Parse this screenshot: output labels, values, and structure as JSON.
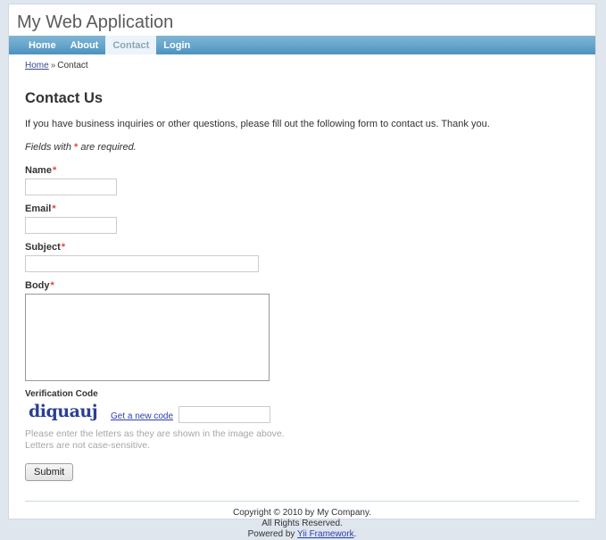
{
  "site": {
    "title": "My Web Application"
  },
  "nav": {
    "items": [
      {
        "label": "Home",
        "active": false
      },
      {
        "label": "About",
        "active": false
      },
      {
        "label": "Contact",
        "active": true
      },
      {
        "label": "Login",
        "active": false
      }
    ]
  },
  "breadcrumb": {
    "home_label": "Home",
    "separator": "»",
    "current": "Contact"
  },
  "main": {
    "heading": "Contact Us",
    "intro": "If you have business inquiries or other questions, please fill out the following form to contact us. Thank you.",
    "required_note_before": "Fields with",
    "required_note_star": "*",
    "required_note_after": "are required."
  },
  "form": {
    "fields": {
      "name": {
        "label": "Name",
        "required_star": "*",
        "value": "",
        "placeholder": ""
      },
      "email": {
        "label": "Email",
        "required_star": "*",
        "value": "",
        "placeholder": ""
      },
      "subject": {
        "label": "Subject",
        "required_star": "*",
        "value": "",
        "placeholder": ""
      },
      "body": {
        "label": "Body",
        "required_star": "*",
        "value": "",
        "placeholder": ""
      },
      "verification": {
        "label": "Verification Code",
        "captcha_text": "diquauj",
        "refresh_link": "Get a new code",
        "value": "",
        "placeholder": "",
        "hint_line1": "Please enter the letters as they are shown in the image above.",
        "hint_line2": "Letters are not case-sensitive."
      }
    },
    "submit_label": "Submit"
  },
  "footer": {
    "line1": "Copyright © 2010 by My Company.",
    "line2": "All Rights Reserved.",
    "powered_prefix": "Powered by",
    "powered_link": "Yii Framework",
    "powered_suffix": "."
  },
  "colors": {
    "nav_top": "#7fb4d4",
    "nav_bottom": "#4c92bd",
    "nav_active_bg": "#eaf4fa",
    "required_star": "#e8413a",
    "link": "#2a3fb0",
    "captcha": "#2b3f93",
    "page_bg": "#dfe6ed",
    "hint_text": "#a6a6a6"
  }
}
